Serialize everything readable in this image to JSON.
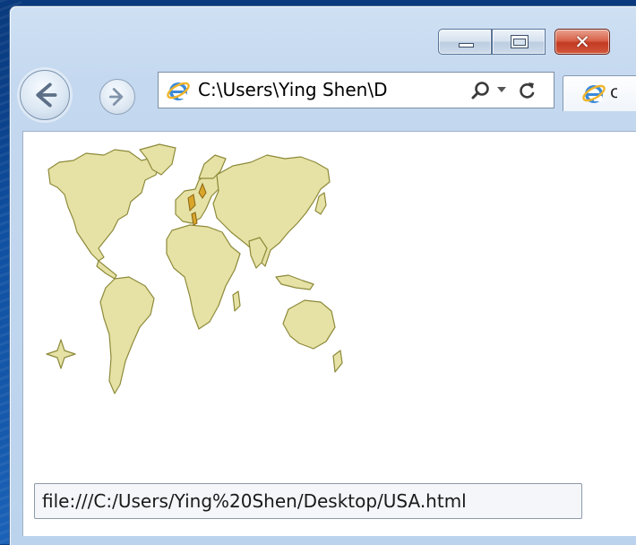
{
  "address_bar": {
    "url": "C:\\Users\\Ying Shen\\Desktop\\USA.html",
    "url_visible": "C:\\Users\\Ying Shen\\D"
  },
  "tab": {
    "label": "c"
  },
  "status_bar": {
    "text": "file:///C:/Users/Ying%20Shen/Desktop/USA.html"
  },
  "icons": {
    "back": "back-arrow-icon",
    "forward": "forward-arrow-icon",
    "page": "ie-logo-icon",
    "search": "search-icon",
    "refresh": "refresh-icon",
    "minimize": "minimize-icon",
    "maximize": "maximize-icon",
    "close": "close-icon"
  },
  "colors": {
    "map_land": "#e6e2a5",
    "map_outline": "#8d8a3a",
    "highlight": "#d9a62a",
    "close_button": "#c8412a",
    "desktop": "#0b3f86"
  }
}
